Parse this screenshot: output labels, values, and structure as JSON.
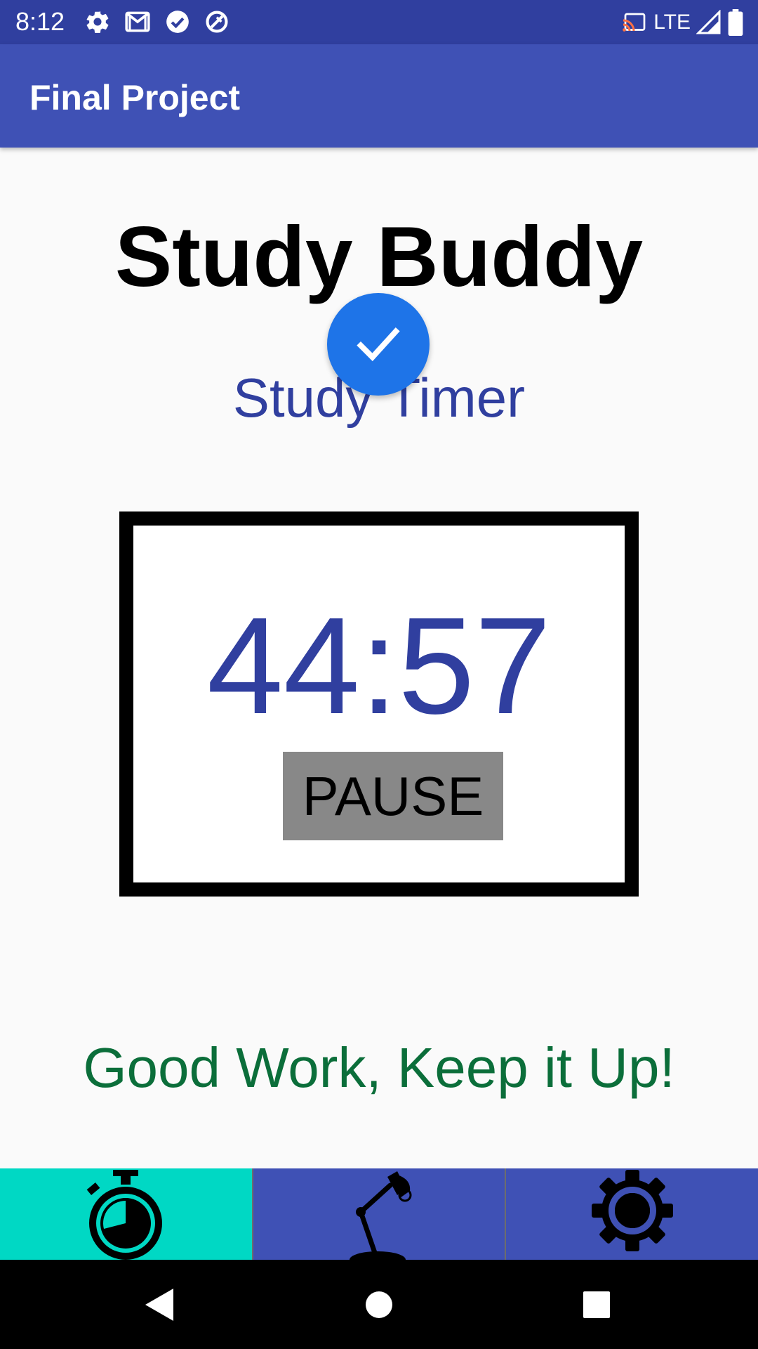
{
  "status_bar": {
    "time": "8:12",
    "network": "LTE",
    "icons_left": [
      "settings-icon",
      "gmail-icon",
      "check-circle-icon",
      "assistant-icon"
    ],
    "icons_right": [
      "cast-icon",
      "signal-icon",
      "battery-icon"
    ]
  },
  "app_bar": {
    "title": "Final Project"
  },
  "main": {
    "heading": "Study Buddy",
    "subheading": "Study Timer",
    "timer": "44:57",
    "pause_label": "PAUSE",
    "message": "Good Work, Keep it Up!"
  },
  "bottom_nav": {
    "items": [
      {
        "icon": "stopwatch-icon",
        "active": true
      },
      {
        "icon": "desk-lamp-icon",
        "active": false
      },
      {
        "icon": "gear-icon",
        "active": false
      }
    ]
  },
  "colors": {
    "status_bar": "#303f9f",
    "app_bar": "#3f51b5",
    "accent_blue": "#303f9f",
    "fab": "#1e74e8",
    "active_tab": "#00d8c4",
    "message": "#0b6e3a",
    "pause_button": "#888888"
  }
}
